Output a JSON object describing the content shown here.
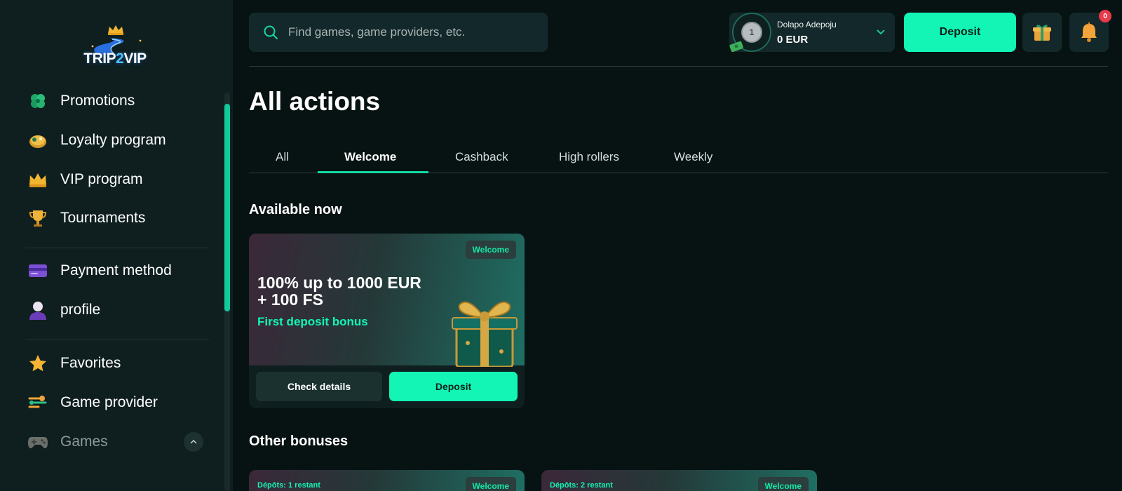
{
  "brand": {
    "logo_text_a": "TRIP",
    "logo_text_b": "2",
    "logo_text_c": "VIP"
  },
  "sidebar": {
    "items": [
      {
        "label": "Promotions",
        "icon": "clover-icon"
      },
      {
        "label": "Loyalty program",
        "icon": "loyalty-coin-icon"
      },
      {
        "label": "VIP program",
        "icon": "crown-icon"
      },
      {
        "label": "Tournaments",
        "icon": "trophy-icon"
      },
      {
        "label": "Payment method",
        "icon": "card-icon"
      },
      {
        "label": "profile",
        "icon": "user-icon"
      },
      {
        "label": "Favorites",
        "icon": "star-icon"
      },
      {
        "label": "Game provider",
        "icon": "provider-icon"
      },
      {
        "label": "Games",
        "icon": "gamepad-icon"
      }
    ]
  },
  "search": {
    "placeholder": "Find games, game providers, etc."
  },
  "account": {
    "level": "1",
    "name": "Dolapo Adepoju",
    "balance": "0 EUR"
  },
  "header": {
    "deposit_label": "Deposit",
    "notifications_count": "0"
  },
  "main": {
    "title": "All actions",
    "tabs": [
      "All",
      "Welcome",
      "Cashback",
      "High rollers",
      "Weekly"
    ],
    "active_tab": "Welcome",
    "available_title": "Available now",
    "other_title": "Other bonuses",
    "bonus_card": {
      "tag": "Welcome",
      "headline_line1": "100% up to 1000 EUR",
      "headline_line2": "+ 100 FS",
      "subtitle": "First deposit bonus",
      "details_label": "Check details",
      "deposit_label": "Deposit"
    },
    "other_cards": [
      {
        "deposits": "Dépôts: 1 restant",
        "tag": "Welcome"
      },
      {
        "deposits": "Dépôts: 2 restant",
        "tag": "Welcome"
      }
    ]
  },
  "colors": {
    "accent": "#12f5b5",
    "background": "#071312",
    "sidebar": "#0f1f1f",
    "panel": "#13282a"
  }
}
